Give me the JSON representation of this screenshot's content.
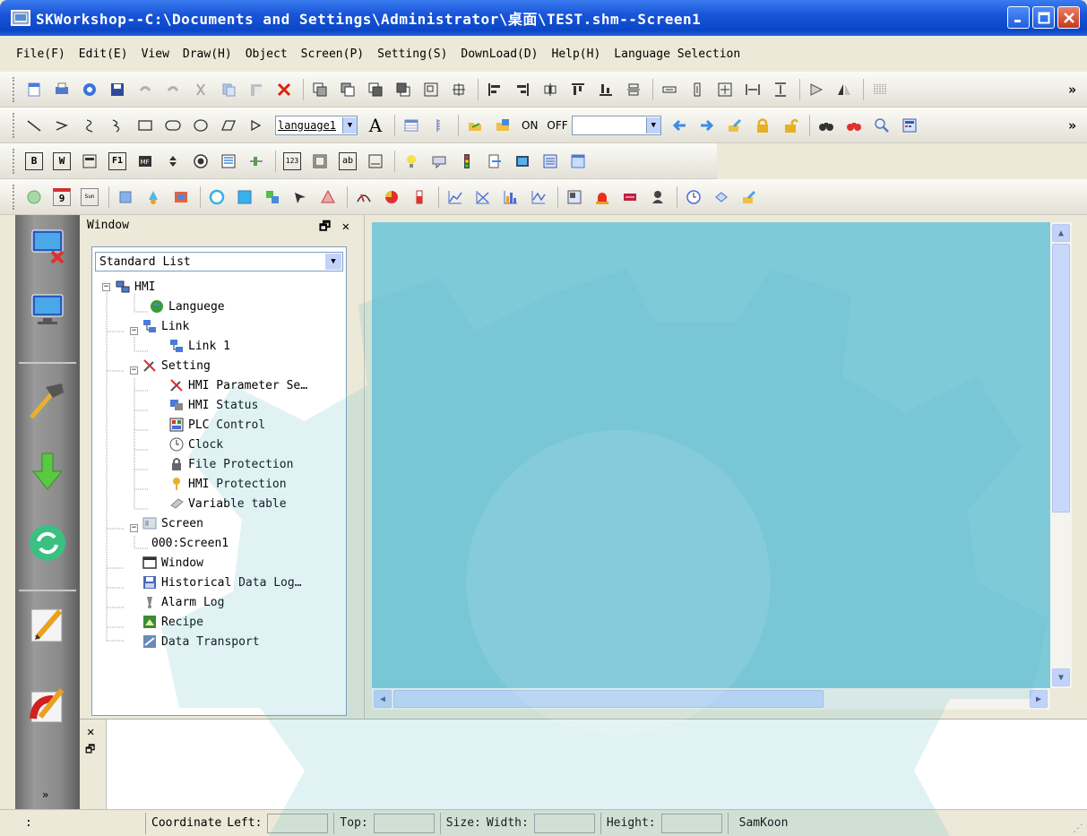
{
  "window": {
    "title": "SKWorkshop--C:\\Documents and Settings\\Administrator\\桌面\\TEST.shm--Screen1"
  },
  "menu": [
    "File(F)",
    "Edit(E)",
    "View",
    "Draw(H)",
    "Object",
    "Screen(P)",
    "Setting(S)",
    "DownLoad(D)",
    "Help(H)",
    "Language Selection"
  ],
  "toolbar2": {
    "language_select": "language1",
    "on_label": "ON",
    "off_label": "OFF"
  },
  "toolbar3": {
    "b": "B",
    "w": "W",
    "f1": "F1",
    "num": "123",
    "ab": "ab"
  },
  "toolbar4": {
    "cal": "9",
    "sun": "Sun"
  },
  "window_pane": {
    "title": "Window",
    "list_type": "Standard List"
  },
  "tree": [
    {
      "label": "HMI"
    },
    {
      "label": "Languege"
    },
    {
      "label": "Link"
    },
    {
      "label": "Link 1"
    },
    {
      "label": "Setting"
    },
    {
      "label": "HMI Parameter Se…"
    },
    {
      "label": "HMI Status"
    },
    {
      "label": "PLC Control"
    },
    {
      "label": "Clock"
    },
    {
      "label": "File Protection"
    },
    {
      "label": "HMI Protection"
    },
    {
      "label": "Variable table"
    },
    {
      "label": "Screen"
    },
    {
      "label": "000:Screen1"
    },
    {
      "label": "Window"
    },
    {
      "label": "Historical Data Log…"
    },
    {
      "label": "Alarm Log"
    },
    {
      "label": "Recipe"
    },
    {
      "label": "Data Transport"
    }
  ],
  "status": {
    "coord_label": "Coordinate",
    "left_label": "Left:",
    "top_label": "Top:",
    "size_label": "Size:",
    "width_label": "Width:",
    "height_label": "Height:",
    "brand": "SamKoon",
    "left_value": "",
    "top_value": "",
    "width_value": "",
    "height_value": ""
  },
  "colors": {
    "canvas": "#7fcad9",
    "titlebar": "#0a46c8"
  }
}
